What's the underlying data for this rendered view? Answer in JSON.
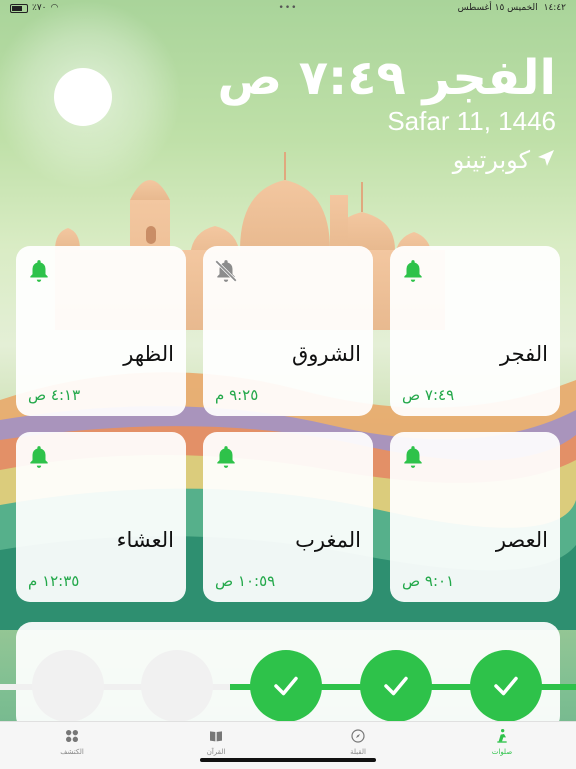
{
  "status_bar": {
    "time": "١٤:٤٢",
    "date": "الخميس ١٥ أغسطس",
    "battery": "٪٧٠",
    "dots": "•••"
  },
  "header": {
    "title": "الفجر ٧:٤٩ ص",
    "hijri_date": "Safar 11, 1446",
    "location": "كوبرتينو",
    "location_icon": "location-arrow-icon"
  },
  "prayers": [
    {
      "name": "الفجر",
      "time": "٧:٤٩ ص",
      "bell": "bell-icon"
    },
    {
      "name": "الشروق",
      "time": "٩:٢٥ م",
      "bell": "bell-muted-icon"
    },
    {
      "name": "الظهر",
      "time": "٤:١٣ ص",
      "bell": "bell-icon"
    },
    {
      "name": "العصر",
      "time": "٩:٠١ ص",
      "bell": "bell-icon"
    },
    {
      "name": "المغرب",
      "time": "١٠:٥٩ ص",
      "bell": "bell-icon"
    },
    {
      "name": "العشاء",
      "time": "١٢:٣٥ م",
      "bell": "bell-icon"
    }
  ],
  "tracker": {
    "completed": 3,
    "total": 5
  },
  "tabs": [
    {
      "label": "صلوات",
      "icon": "prayer-person-icon",
      "active": true
    },
    {
      "label": "القبلة",
      "icon": "compass-icon",
      "active": false
    },
    {
      "label": "القرآن",
      "icon": "book-icon",
      "active": false
    },
    {
      "label": "الكتشف",
      "icon": "grid-icon",
      "active": false
    }
  ],
  "colors": {
    "accent": "#2ec24a",
    "time_text": "#23a84a",
    "card_bg": "#ffffff"
  }
}
